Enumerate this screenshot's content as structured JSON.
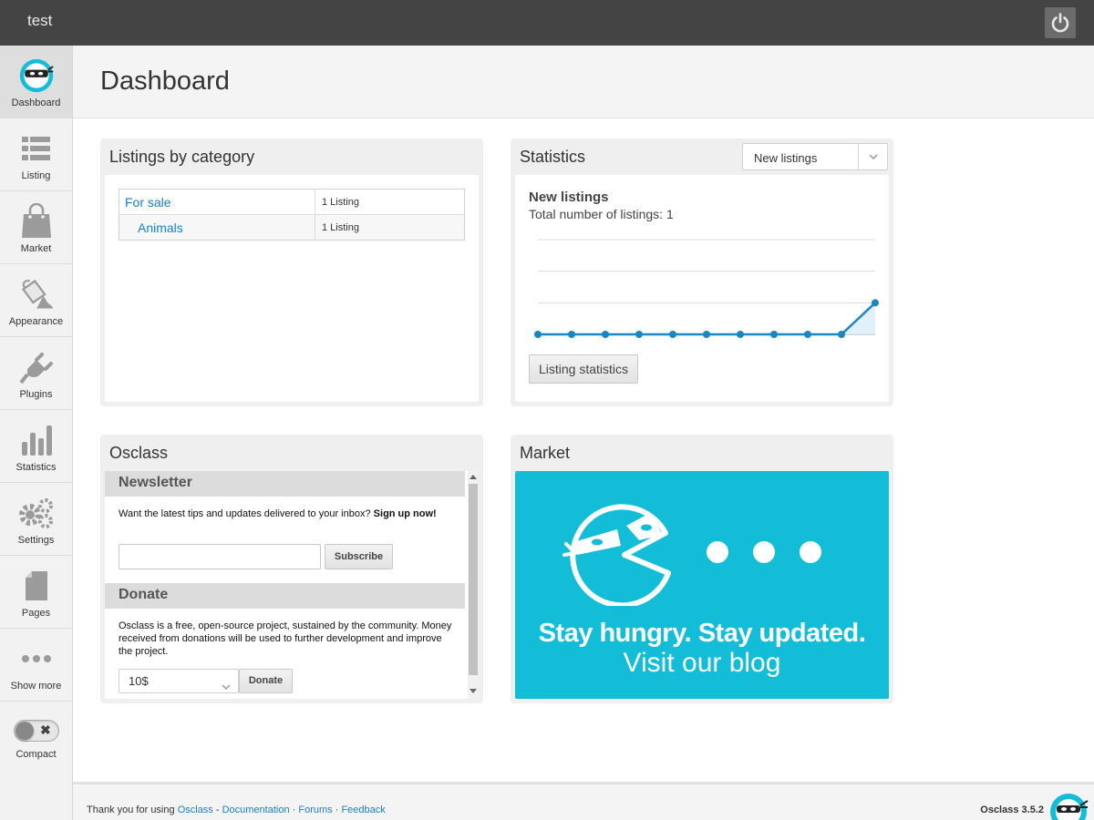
{
  "topbar": {
    "site_name": "test"
  },
  "sidebar": {
    "items": [
      {
        "label": "Dashboard",
        "icon": "ninja-logo-icon",
        "active": true
      },
      {
        "label": "Listing",
        "icon": "list-icon"
      },
      {
        "label": "Market",
        "icon": "shopping-bag-icon"
      },
      {
        "label": "Appearance",
        "icon": "paint-bucket-icon"
      },
      {
        "label": "Plugins",
        "icon": "plug-icon"
      },
      {
        "label": "Statistics",
        "icon": "bar-chart-icon"
      },
      {
        "label": "Settings",
        "icon": "gears-icon"
      },
      {
        "label": "Pages",
        "icon": "page-icon"
      },
      {
        "label": "Show more",
        "icon": "more-dots-icon"
      }
    ],
    "compact": {
      "label": "Compact",
      "enabled": false
    }
  },
  "header": {
    "title": "Dashboard"
  },
  "listings_widget": {
    "title": "Listings by category",
    "rows": [
      {
        "name": "For sale",
        "count": "1 Listing"
      },
      {
        "name": "Animals",
        "count": "1 Listing"
      }
    ]
  },
  "statistics_widget": {
    "title": "Statistics",
    "select_value": "New listings",
    "heading": "New listings",
    "subtitle": "Total number of listings: 1",
    "button_label": "Listing statistics",
    "accent_color": "#1a87c0"
  },
  "chart_data": {
    "type": "area",
    "x": [
      1,
      2,
      3,
      4,
      5,
      6,
      7,
      8,
      9,
      10,
      11
    ],
    "series": [
      {
        "values": [
          0,
          0,
          0,
          0,
          0,
          0,
          0,
          0,
          0,
          0,
          1
        ]
      }
    ],
    "ylim": [
      0,
      3
    ],
    "grid": true
  },
  "osclass_widget": {
    "title": "Osclass",
    "newsletter": {
      "heading": "Newsletter",
      "text": "Want the latest tips and updates delivered to your inbox?",
      "text_bold": "Sign up now!",
      "input_value": "",
      "button_label": "Subscribe"
    },
    "donate": {
      "heading": "Donate",
      "text": "Osclass is a free, open-source project, sustained by the community. Money received from donations will be used to further development and improve the project.",
      "amount": "10$",
      "button_label": "Donate"
    }
  },
  "market_widget": {
    "title": "Market",
    "banner_line1": "Stay hungry. Stay updated.",
    "banner_line2": "Visit our blog",
    "banner_color": "#13bcd7"
  },
  "footer": {
    "prefix": "Thank you for using",
    "links": [
      "Osclass",
      "Documentation",
      "Forums",
      "Feedback"
    ],
    "separator_dash": " - ",
    "separator_dot": " · ",
    "version": "Osclass 3.5.2"
  }
}
